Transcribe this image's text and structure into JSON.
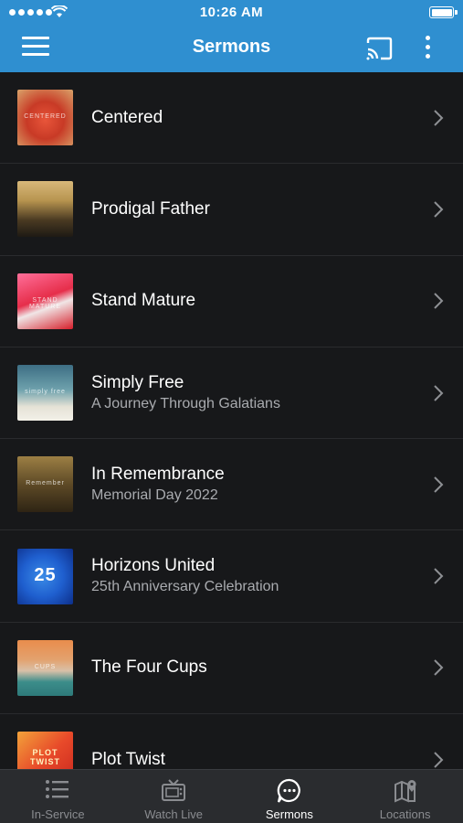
{
  "status_bar": {
    "time": "10:26 AM"
  },
  "header": {
    "title": "Sermons",
    "menu_icon": "hamburger-menu-icon",
    "cast_icon": "cast-icon",
    "more_icon": "more-vertical-icon",
    "background_color": "#2f8fd0"
  },
  "sermons": [
    {
      "title": "Centered",
      "subtitle": "",
      "thumb_text": "CENTERED"
    },
    {
      "title": "Prodigal Father",
      "subtitle": "",
      "thumb_text": ""
    },
    {
      "title": "Stand Mature",
      "subtitle": "",
      "thumb_text": "STAND MATURE"
    },
    {
      "title": "Simply Free",
      "subtitle": "A Journey Through Galatians",
      "thumb_text": "simply free"
    },
    {
      "title": "In Remembrance",
      "subtitle": "Memorial Day 2022",
      "thumb_text": "Remember"
    },
    {
      "title": "Horizons United",
      "subtitle": "25th Anniversary Celebration",
      "thumb_text": "25"
    },
    {
      "title": "The Four Cups",
      "subtitle": "",
      "thumb_text": "CUPS"
    },
    {
      "title": "Plot Twist",
      "subtitle": "",
      "thumb_text": "PLOT TWIST"
    }
  ],
  "tabs": [
    {
      "label": "In-Service",
      "icon": "list-icon",
      "active": false
    },
    {
      "label": "Watch Live",
      "icon": "tv-icon",
      "active": false
    },
    {
      "label": "Sermons",
      "icon": "chat-bubble-icon",
      "active": true
    },
    {
      "label": "Locations",
      "icon": "map-pin-icon",
      "active": false
    }
  ]
}
